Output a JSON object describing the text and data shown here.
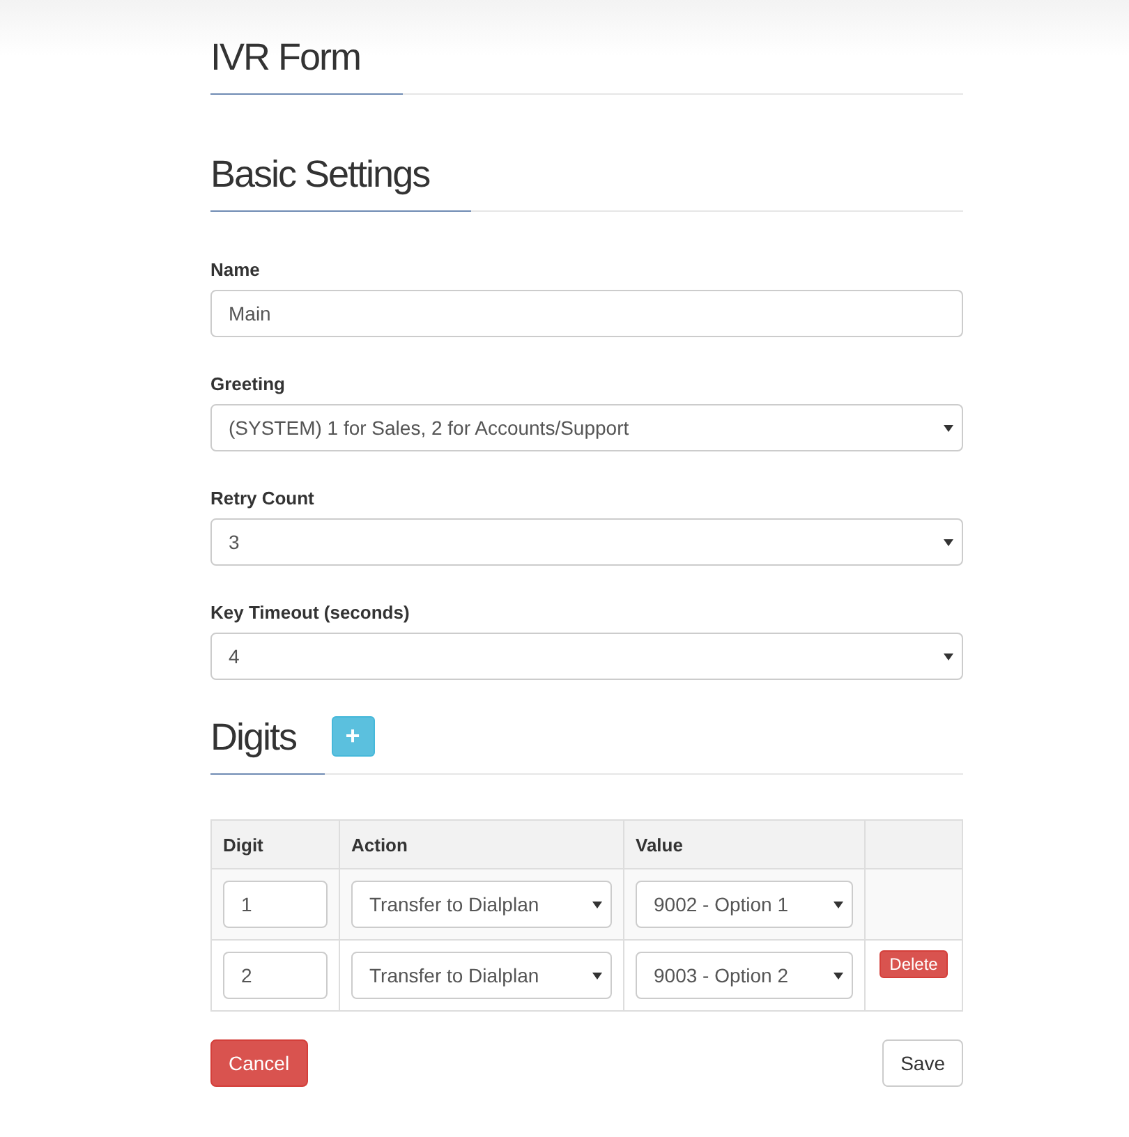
{
  "page_title": "IVR Form",
  "basic_settings": {
    "heading": "Basic Settings",
    "fields": [
      {
        "kind": "text",
        "label": "Name",
        "value": "Main"
      },
      {
        "kind": "select",
        "label": "Greeting",
        "value": "(SYSTEM) 1 for Sales, 2 for Accounts/Support"
      },
      {
        "kind": "select",
        "label": "Retry Count",
        "value": "3"
      },
      {
        "kind": "select",
        "label": "Key Timeout (seconds)",
        "value": "4"
      }
    ]
  },
  "digits": {
    "heading": "Digits",
    "add_button": "+",
    "table": {
      "columns": [
        "Digit",
        "Action",
        "Value"
      ],
      "rows": [
        {
          "digit": "1",
          "action": "Transfer to Dialplan",
          "value": "9002 - Option 1"
        },
        {
          "digit": "2",
          "action": "Transfer to Dialplan",
          "value": "9003 - Option 2",
          "delete_button": "Delete"
        }
      ]
    }
  },
  "buttons": {
    "cancel": "Cancel",
    "save": "Save"
  }
}
